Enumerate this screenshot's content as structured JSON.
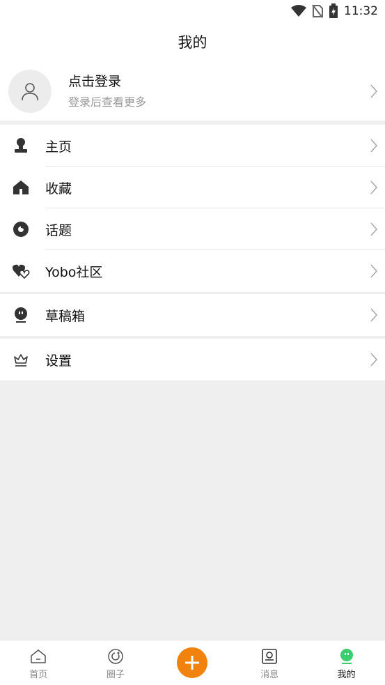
{
  "status_bar": {
    "time": "11:32"
  },
  "header": {
    "title": "我的"
  },
  "profile": {
    "title": "点击登录",
    "subtitle": "登录后查看更多"
  },
  "menu_group_1": [
    {
      "label": "主页",
      "icon": "person-bust-icon"
    },
    {
      "label": "收藏",
      "icon": "house-icon"
    },
    {
      "label": "话题",
      "icon": "topic-circle-icon"
    },
    {
      "label": "Yobo社区",
      "icon": "hearts-icon"
    }
  ],
  "menu_group_2": [
    {
      "label": "草稿箱",
      "icon": "draft-face-icon"
    }
  ],
  "menu_group_3": [
    {
      "label": "设置",
      "icon": "crown-icon"
    }
  ],
  "tabbar": {
    "tabs": [
      {
        "label": "首页",
        "icon": "home-icon"
      },
      {
        "label": "圈子",
        "icon": "circle-icon"
      },
      {
        "label": "",
        "icon": "plus-icon"
      },
      {
        "label": "消息",
        "icon": "message-icon"
      },
      {
        "label": "我的",
        "icon": "mine-icon"
      }
    ],
    "active_index": 4
  },
  "colors": {
    "accent_orange": "#f2820e",
    "active_green": "#3dcc6e",
    "background": "#efefef"
  }
}
